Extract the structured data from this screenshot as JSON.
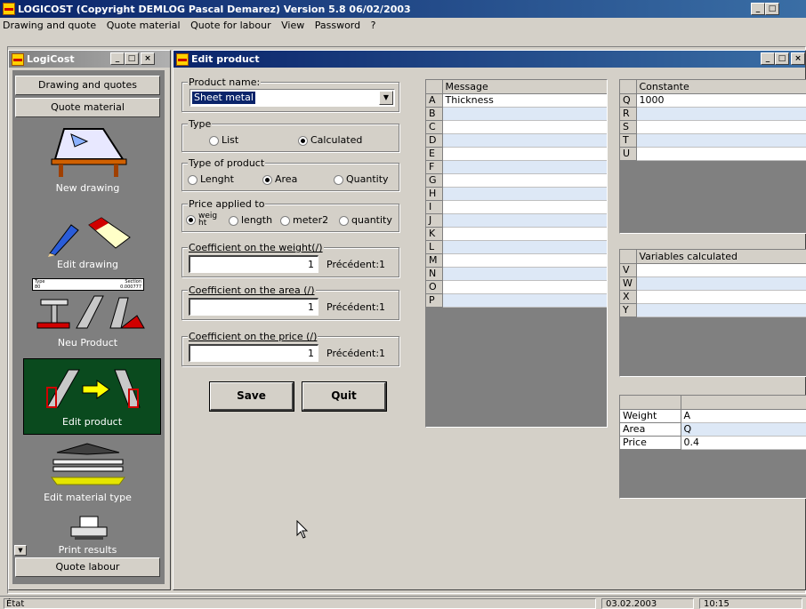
{
  "app": {
    "title": "LOGICOST (Copyright DEMLOG Pascal Demarez) Version 5.8 06/02/2003"
  },
  "menu": [
    "Drawing and quote",
    "Quote material",
    "Quote for labour",
    "View",
    "Password",
    "?"
  ],
  "sidebar": {
    "title": "LogiCost",
    "top_buttons": [
      "Drawing and quotes",
      "Quote material"
    ],
    "items": [
      {
        "label": "New drawing",
        "icon": "drawing-board-icon"
      },
      {
        "label": "Edit drawing",
        "icon": "pencil-eraser-icon"
      },
      {
        "label": "Neu Product",
        "icon": "steel-profile-icon"
      },
      {
        "label": "Edit product",
        "icon": "edit-profile-icon",
        "selected": true
      },
      {
        "label": "Edit material type",
        "icon": "material-sheets-icon"
      },
      {
        "label": "Print results",
        "icon": "printer-icon"
      }
    ],
    "mini_form": {
      "left": "Type",
      "right": "Section",
      "left_value": "80",
      "right_value": "0.000777"
    },
    "bottom_button": "Quote labour"
  },
  "edit": {
    "title": "Edit product",
    "product_name_label": "Product name:",
    "product_name_value": "Sheet metal",
    "type_label": "Type",
    "type_options": [
      "List",
      "Calculated"
    ],
    "type_selected": "Calculated",
    "product_type_label": "Type of product",
    "product_type_options": [
      "Lenght",
      "Area",
      "Quantity"
    ],
    "product_type_selected": "Area",
    "price_label": "Price applied to",
    "price_options": [
      "weig ht",
      "length",
      "meter2",
      "quantity"
    ],
    "price_selected": "weig ht",
    "coef_weight_label": "Coefficient on the weight(/)",
    "coef_weight_value": "1",
    "coef_weight_prev": "Précédent:1",
    "coef_area_label": "Coefficient on the area  (/)",
    "coef_area_value": "1",
    "coef_area_prev": "Précédent:1",
    "coef_price_label": "Coefficient on the price (/)",
    "coef_price_value": "1",
    "coef_price_prev": "Précédent:1",
    "save_label": "Save",
    "quit_label": "Quit"
  },
  "message_grid": {
    "header": "Message",
    "rows": [
      {
        "key": "A",
        "value": "Thickness"
      },
      {
        "key": "B",
        "value": ""
      },
      {
        "key": "C",
        "value": ""
      },
      {
        "key": "D",
        "value": ""
      },
      {
        "key": "E",
        "value": ""
      },
      {
        "key": "F",
        "value": ""
      },
      {
        "key": "G",
        "value": ""
      },
      {
        "key": "H",
        "value": ""
      },
      {
        "key": "I",
        "value": ""
      },
      {
        "key": "J",
        "value": ""
      },
      {
        "key": "K",
        "value": ""
      },
      {
        "key": "L",
        "value": ""
      },
      {
        "key": "M",
        "value": ""
      },
      {
        "key": "N",
        "value": ""
      },
      {
        "key": "O",
        "value": ""
      },
      {
        "key": "P",
        "value": ""
      }
    ]
  },
  "constante_grid": {
    "header": "Constante",
    "rows": [
      {
        "key": "Q",
        "value": "1000"
      },
      {
        "key": "R",
        "value": ""
      },
      {
        "key": "S",
        "value": ""
      },
      {
        "key": "T",
        "value": ""
      },
      {
        "key": "U",
        "value": ""
      }
    ]
  },
  "variables_grid": {
    "header": "Variables calculated",
    "rows": [
      {
        "key": "V",
        "value": ""
      },
      {
        "key": "W",
        "value": ""
      },
      {
        "key": "X",
        "value": ""
      },
      {
        "key": "Y",
        "value": ""
      }
    ]
  },
  "formula_grid": {
    "rows": [
      {
        "key": "Weight",
        "value": "A"
      },
      {
        "key": "Area",
        "value": "Q"
      },
      {
        "key": "Price",
        "value": "0.4"
      }
    ]
  },
  "status": {
    "left": "État",
    "date": "03.02.2003",
    "time": "10:15"
  }
}
